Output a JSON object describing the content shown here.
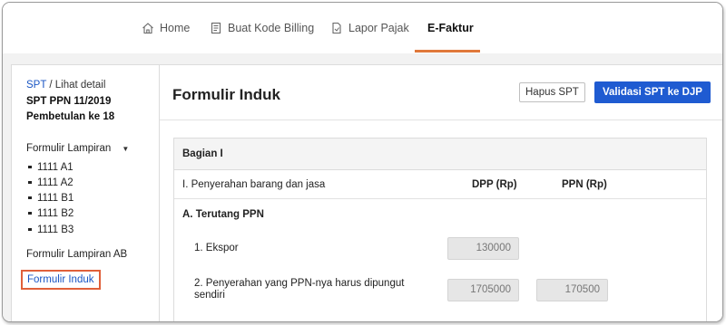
{
  "nav": {
    "items": [
      {
        "label": "Home",
        "icon": "home-icon"
      },
      {
        "label": "Buat Kode Billing",
        "icon": "billing-icon"
      },
      {
        "label": "Lapor Pajak",
        "icon": "report-icon"
      },
      {
        "label": "E-Faktur",
        "icon": "",
        "active": true
      }
    ],
    "accent_color": "#e0783a"
  },
  "sidebar": {
    "crumb_link": "SPT",
    "crumb_rest": " / Lihat detail",
    "spt_line1": "SPT PPN 11/2019",
    "spt_line2": "Pembetulan ke 18",
    "lampiran_title": "Formulir Lampiran",
    "lampiran_items": [
      "1111 A1",
      "1111 A2",
      "1111 B1",
      "1111 B2",
      "1111 B3"
    ],
    "lampiran_ab": "Formulir Lampiran AB",
    "induk": "Formulir Induk"
  },
  "main": {
    "title": "Formulir Induk",
    "hapus_label": "Hapus SPT",
    "validasi_label": "Validasi SPT ke DJP",
    "primary_color": "#1f5bd1",
    "bagian": "Bagian I",
    "section_header": "I. Penyerahan barang dan jasa",
    "col_dpp": "DPP (Rp)",
    "col_ppn": "PPN (Rp)",
    "sub_a": "A. Terutang PPN",
    "rows": [
      {
        "label": "1. Ekspor",
        "dpp": "130000",
        "ppn": ""
      },
      {
        "label_line1": "2. Penyerahan yang PPN-nya harus dipungut",
        "label_line2": "sendiri",
        "dpp": "1705000",
        "ppn": "170500"
      }
    ]
  }
}
